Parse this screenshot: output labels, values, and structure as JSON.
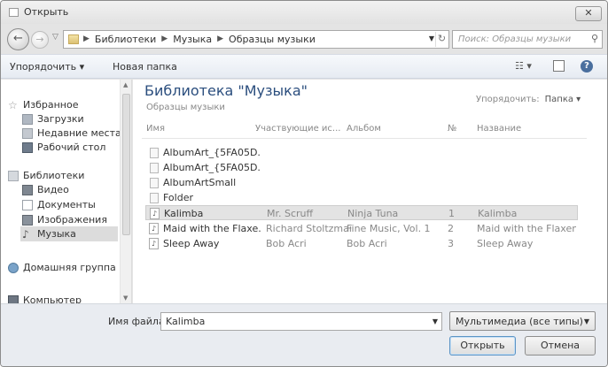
{
  "window": {
    "title": "Открыть",
    "close_label": "✕"
  },
  "navbar": {
    "breadcrumbs": [
      "Библиотеки",
      "Музыка",
      "Образцы музыки"
    ],
    "search_placeholder": "Поиск: Образцы музыки"
  },
  "toolbar": {
    "organize_label": "Упорядочить ▾",
    "new_folder_label": "Новая папка"
  },
  "sidebar": {
    "items": [
      {
        "label": "Избранное",
        "icon": "star-icon"
      },
      {
        "label": "Загрузки",
        "icon": "downloads-icon"
      },
      {
        "label": "Недавние места",
        "icon": "recent-places-icon"
      },
      {
        "label": "Рабочий стол",
        "icon": "desktop-icon"
      },
      {
        "label": "Библиотеки",
        "icon": "libraries-icon"
      },
      {
        "label": "Видео",
        "icon": "video-icon"
      },
      {
        "label": "Документы",
        "icon": "documents-icon"
      },
      {
        "label": "Изображения",
        "icon": "images-icon"
      },
      {
        "label": "Музыка",
        "icon": "music-icon"
      },
      {
        "label": "Домашняя группа",
        "icon": "homegroup-icon"
      },
      {
        "label": "Компьютер",
        "icon": "computer-icon"
      }
    ]
  },
  "main": {
    "library_title": "Библиотека \"Музыка\"",
    "library_subtitle": "Образцы музыки",
    "arrange_label": "Упорядочить:",
    "arrange_value": "Папка ▾",
    "columns": [
      "Имя",
      "Участвующие ис...",
      "Альбом",
      "№",
      "Название"
    ],
    "rows": [
      {
        "name": "AlbumArt_{5FA05D...",
        "artist": "",
        "album": "",
        "no": "",
        "title": "",
        "kind": "image"
      },
      {
        "name": "AlbumArt_{5FA05D...",
        "artist": "",
        "album": "",
        "no": "",
        "title": "",
        "kind": "image"
      },
      {
        "name": "AlbumArtSmall",
        "artist": "",
        "album": "",
        "no": "",
        "title": "",
        "kind": "image"
      },
      {
        "name": "Folder",
        "artist": "",
        "album": "",
        "no": "",
        "title": "",
        "kind": "image"
      },
      {
        "name": "Kalimba",
        "artist": "Mr. Scruff",
        "album": "Ninja Tuna",
        "no": "1",
        "title": "Kalimba",
        "kind": "audio"
      },
      {
        "name": "Maid with the Flaxe...",
        "artist": "Richard Stoltzman...",
        "album": "Fine Music, Vol. 1",
        "no": "2",
        "title": "Maid with the Flaxen H...",
        "kind": "audio"
      },
      {
        "name": "Sleep Away",
        "artist": "Bob Acri",
        "album": "Bob Acri",
        "no": "3",
        "title": "Sleep Away",
        "kind": "audio"
      }
    ],
    "selected_row": 4
  },
  "bottom": {
    "filename_label": "Имя файла:",
    "filename_value": "Kalimba",
    "filetype_value": "Мультимедиа (все типы)",
    "open_label": "Открыть",
    "cancel_label": "Отмена"
  }
}
